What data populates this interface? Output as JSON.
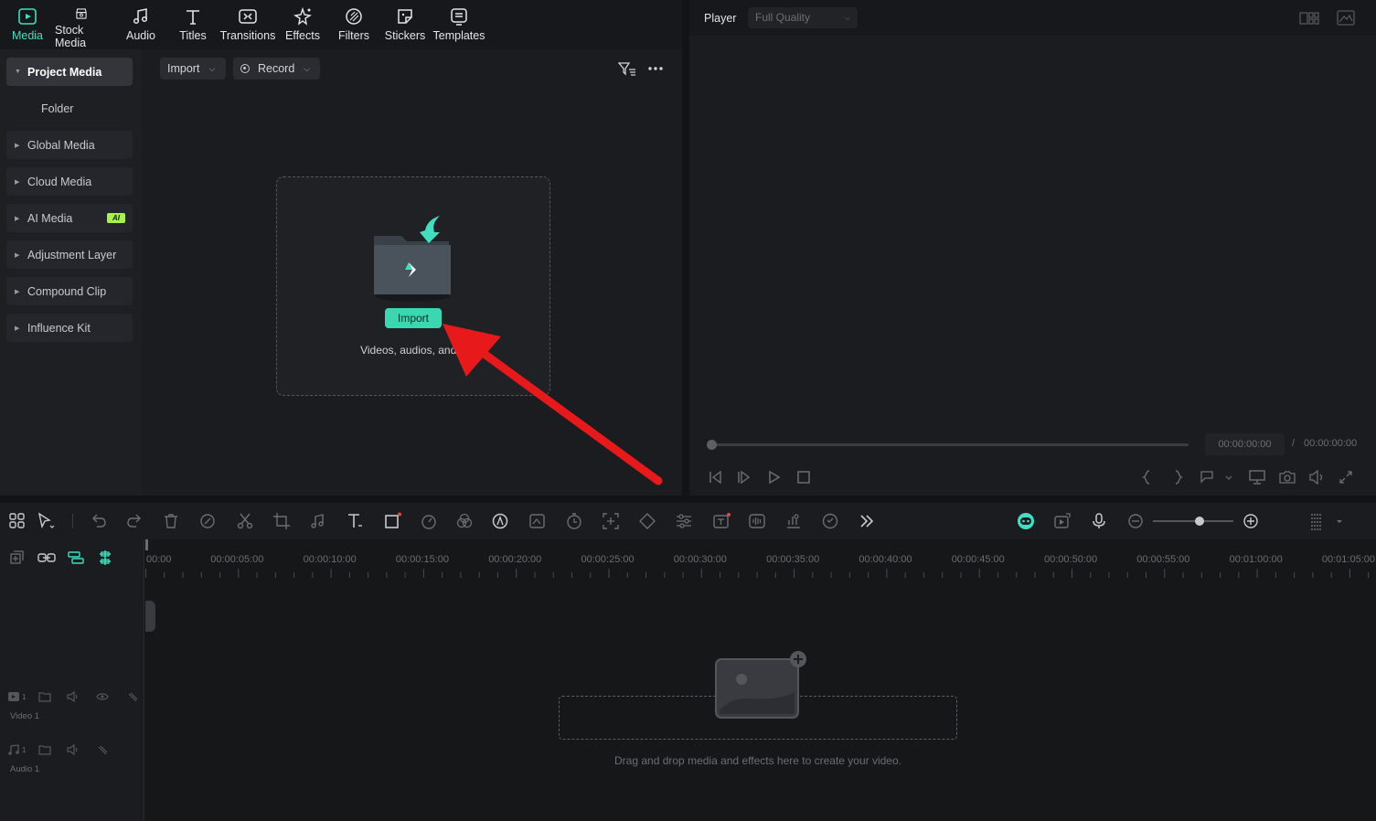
{
  "tabs": [
    {
      "label": "Media",
      "icon": "media-icon"
    },
    {
      "label": "Stock Media",
      "icon": "stock-media-icon"
    },
    {
      "label": "Audio",
      "icon": "music-note-icon"
    },
    {
      "label": "Titles",
      "icon": "text-t-icon"
    },
    {
      "label": "Transitions",
      "icon": "transition-icon"
    },
    {
      "label": "Effects",
      "icon": "effects-sparkle-icon"
    },
    {
      "label": "Filters",
      "icon": "filter-icon"
    },
    {
      "label": "Stickers",
      "icon": "sticker-icon"
    },
    {
      "label": "Templates",
      "icon": "template-icon"
    }
  ],
  "sidebar": {
    "items": [
      {
        "label": "Project Media"
      },
      {
        "label": "Global Media"
      },
      {
        "label": "Cloud Media"
      },
      {
        "label": "AI Media",
        "badge": "AI"
      },
      {
        "label": "Adjustment Layer"
      },
      {
        "label": "Compound Clip"
      },
      {
        "label": "Influence Kit"
      }
    ],
    "folder_label": "Folder"
  },
  "media_toolbar": {
    "import_label": "Import",
    "record_label": "Record"
  },
  "drop_zone": {
    "button_label": "Import",
    "hint": "Videos, audios, and in"
  },
  "player": {
    "title": "Player",
    "quality": "Full Quality",
    "current_time": "00:00:00:00",
    "separator": "/",
    "total_time": "00:00:00:00"
  },
  "timeline": {
    "ruler": [
      "00:00",
      "00:00:05:00",
      "00:00:10:00",
      "00:00:15:00",
      "00:00:20:00",
      "00:00:25:00",
      "00:00:30:00",
      "00:00:35:00",
      "00:00:40:00",
      "00:00:45:00",
      "00:00:50:00",
      "00:00:55:00",
      "00:01:00:00",
      "00:01:05:00"
    ],
    "tracks": [
      {
        "label": "Video 1",
        "number": "1"
      },
      {
        "label": "Audio 1",
        "number": "1"
      }
    ],
    "hint": "Drag and drop media and effects here to create your video."
  },
  "colors": {
    "accent": "#3fe0c0",
    "arrow": "#e8191a",
    "ai_badge": "#a8f04a"
  }
}
